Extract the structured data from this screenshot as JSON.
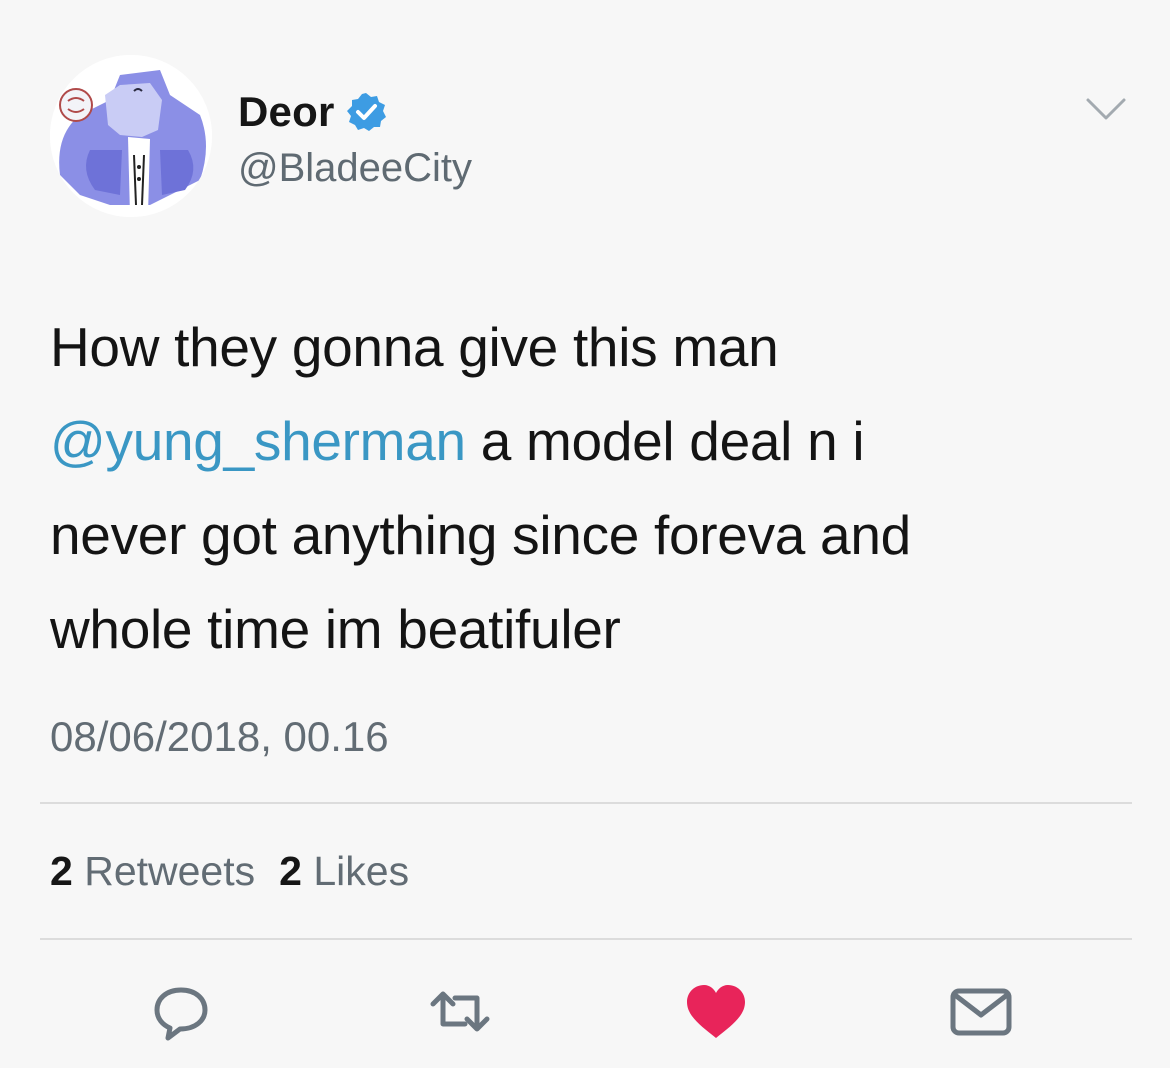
{
  "user": {
    "display_name": "Deor",
    "handle": "@BladeeCity",
    "verified_icon": "verified-badge-icon",
    "avatar_icon": "avatar-image"
  },
  "tweet": {
    "line1": "How they gonna give this man",
    "mention": "@yung_sherman",
    "line2_rest": " a model deal n i",
    "line3": "never got anything since foreva and",
    "line4": "whole time im beatifuler",
    "timestamp": "08/06/2018, 00.16"
  },
  "stats": {
    "retweets_count": "2",
    "retweets_label": "Retweets",
    "likes_count": "2",
    "likes_label": "Likes"
  },
  "actions": {
    "reply_icon": "reply-icon",
    "retweet_icon": "retweet-icon",
    "like_icon": "heart-icon",
    "dm_icon": "mail-icon"
  },
  "colors": {
    "mention": "#3a97c4",
    "verified": "#3d9ce3",
    "like": "#e8245a",
    "muted": "#626c74"
  }
}
